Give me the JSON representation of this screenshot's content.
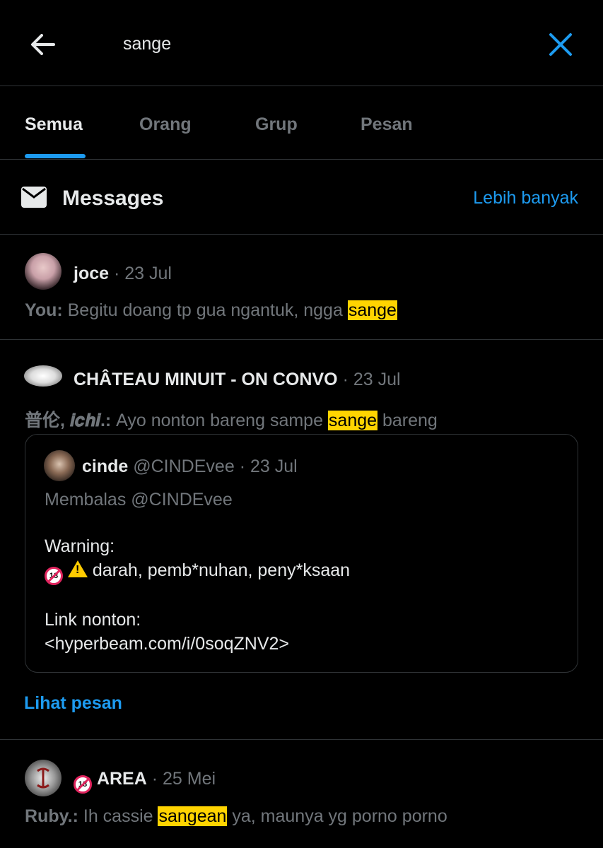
{
  "header": {
    "search_query": "sange",
    "back_icon": "arrow-left-icon",
    "close_icon": "close-icon",
    "accent": "#1d9bf0"
  },
  "tabs": [
    {
      "label": "Semua",
      "active": true
    },
    {
      "label": "Orang",
      "active": false
    },
    {
      "label": "Grup",
      "active": false
    },
    {
      "label": "Pesan",
      "active": false
    }
  ],
  "section": {
    "icon": "envelope-icon",
    "title": "Messages",
    "more_label": "Lebih banyak"
  },
  "messages": [
    {
      "name": "joce",
      "date": "23 Jul",
      "sender": "You:",
      "text_before": " Begitu doang tp gua ngantuk, ngga ",
      "highlight": "sange",
      "text_after": ""
    },
    {
      "name": "CHÂTEAU MINUIT - ON CONVO",
      "date": "23 Jul",
      "sender": "普伦, 𝒊𝒄𝒉𝒊.:",
      "text_before": " Ayo nonton bareng sampe ",
      "highlight": "sange",
      "text_after": " bareng",
      "quote": {
        "name": "cinde",
        "handle": "@CINDEvee",
        "date": "23 Jul",
        "reply_to": "Membalas @CINDEvee",
        "line1": "Warning:",
        "line2": " darah, pemb*nuhan, peny*ksaan",
        "line3": "Link nonton:",
        "line4": "<hyperbeam.com/i/0soqZNV2>"
      },
      "action": "Lihat pesan"
    },
    {
      "name": "AREA",
      "date": "25 Mei",
      "sender": "Ruby.:",
      "text_before": " Ih cassie ",
      "highlight": "sangean",
      "text_after": " ya, maunya yg porno porno"
    }
  ],
  "colors": {
    "background": "#000000",
    "muted": "#71767b",
    "highlight": "#ffd400",
    "divider": "#2f3336"
  }
}
